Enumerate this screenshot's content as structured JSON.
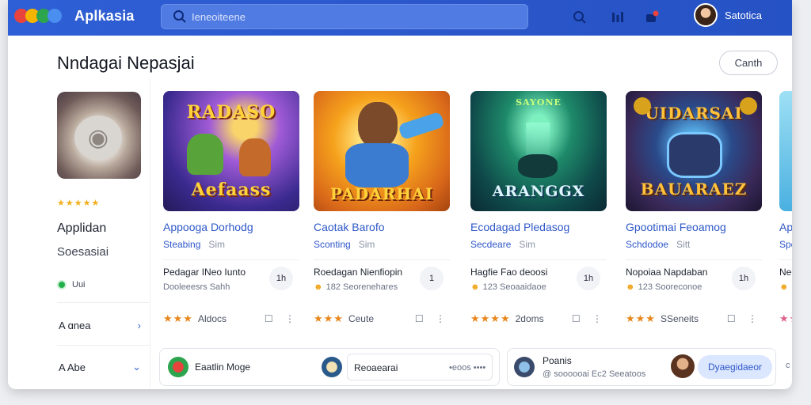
{
  "app": {
    "name": "Aplkasia"
  },
  "topbar": {
    "search_placeholder": "Ieneoiteene",
    "icons": [
      "search-icon",
      "filter-icon",
      "notification-icon"
    ],
    "user_name": "Satotica"
  },
  "page": {
    "heading": "Nndagai Nepasjai",
    "top_button": "Canth"
  },
  "sidebar": {
    "rating": "★★★★★",
    "title": "Applidan",
    "subtitle": "Soesasiai",
    "status": "Uui",
    "menu": [
      {
        "label": "A  ɑnea",
        "chevron": "›"
      },
      {
        "label": "A  Abe",
        "chevron": "⌄"
      }
    ]
  },
  "cards": [
    {
      "art_text_top": "RADASO",
      "art_text_bottom": "Aefaass",
      "title": "Appooga Dorhodg",
      "genre": "Steabing",
      "platform": "Sim",
      "row_title": "Pedagar INeo Iunto",
      "row_sub": "Dooleeesrs Sahh",
      "pill": "1h",
      "foot_stars": "★★★",
      "foot_text": "Aldocs",
      "actions": "☐ ⋮"
    },
    {
      "art_text_top": "",
      "art_text_bottom": "PADARHAI",
      "title": "Caotak Barofo",
      "genre": "Sconting",
      "platform": "Sim",
      "row_title": "Roedagan Nienfiopin",
      "row_sub": "182 Seorenehares",
      "pill": "1",
      "foot_stars": "★★★",
      "foot_text": "Ceute",
      "actions": "☐ ⋮"
    },
    {
      "art_text_top": "SAYONE",
      "art_text_bottom": "ARANGGX",
      "title": "Ecodagad Pledasog",
      "genre": "Secdeare",
      "platform": "Sim",
      "row_title": "Hagfie Fao deoosi",
      "row_sub": "123 Seoaaidaoe",
      "pill": "1h",
      "foot_stars": "★★★★",
      "foot_text": "2doms",
      "actions": "☐ ⋮"
    },
    {
      "art_text_top": "UIDARSAI",
      "art_text_bottom": "BAUARAEZ",
      "title": "Gpootimai Feoamog",
      "genre": "Schdodoe",
      "platform": "Sitt",
      "row_title": "Nopoiaa Napdaban",
      "row_sub": "123 Sooreconoe",
      "pill": "1h",
      "foot_stars": "★★★",
      "foot_text": "SSeneits",
      "actions": "☐ ⋮"
    },
    {
      "art_text_top": "",
      "art_text_bottom": "",
      "title": "App",
      "genre": "Spc",
      "platform": "",
      "row_title": "Neo",
      "row_sub": "",
      "pill": "",
      "foot_stars": "★★",
      "foot_text": "",
      "actions": ""
    }
  ],
  "bottom": {
    "item1_label": "Eaatlin Moge",
    "item2_label": "Reoaearai",
    "item2_meta": "•eoos ••••",
    "item3_title": "Poanis",
    "item3_meta": "@ soooooai  Ec2 Seeatoos",
    "item3_button": "Dyaegidaeor",
    "overflow": "c"
  },
  "colors": {
    "topbar": "#2f5fd6",
    "accent": "#2f58c8",
    "star": "#f2b01e"
  }
}
